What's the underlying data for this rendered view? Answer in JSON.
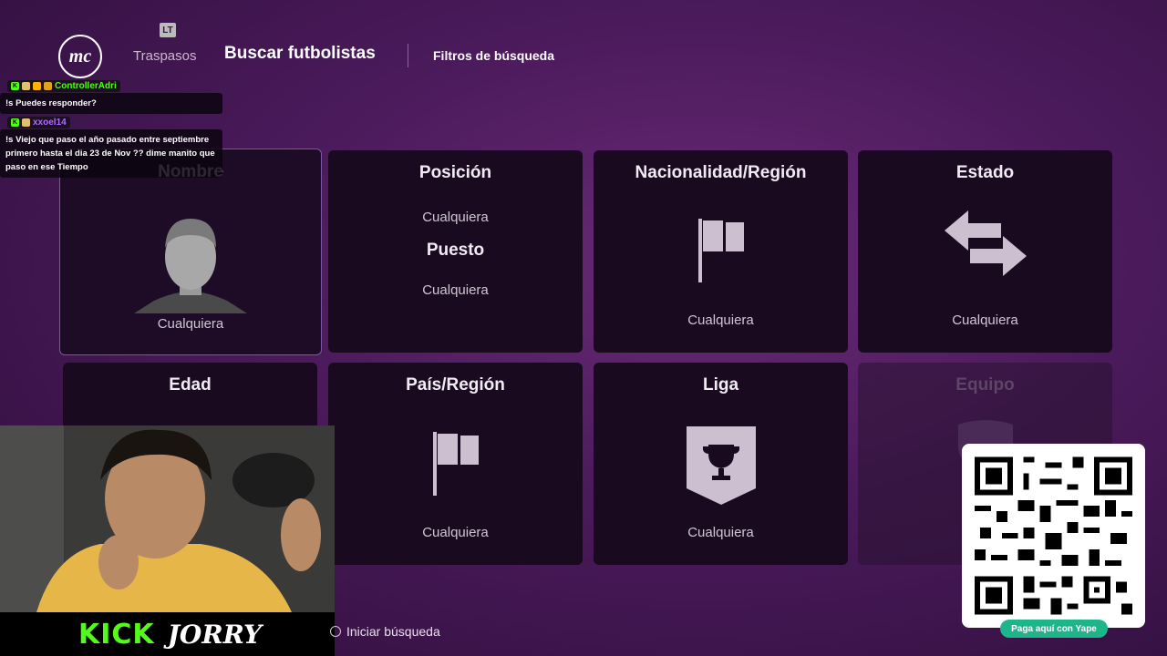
{
  "header": {
    "logo_text": "mc",
    "badge": "LT",
    "nav_transfers": "Traspasos",
    "nav_active": "Buscar futbolistas",
    "filters": "Filtros de búsqueda"
  },
  "chat": [
    {
      "user": "ControllerAdri",
      "user_color": "#53fc18",
      "text": "!s Puedes responder?"
    },
    {
      "user": "xxoel14",
      "user_color": "#b06bff",
      "text": "!s Viejo que paso el año pasado entre septiembre primero hasta el dia 23 de Nov ?? dime manito que paso en ese Tiempo"
    }
  ],
  "cards": {
    "nombre": {
      "title": "Nombre",
      "value": "Cualquiera"
    },
    "posicion": {
      "title": "Posición",
      "value": "Cualquiera",
      "title2": "Puesto",
      "value2": "Cualquiera"
    },
    "nacionalidad": {
      "title": "Nacionalidad/Región",
      "value": "Cualquiera"
    },
    "estado": {
      "title": "Estado",
      "value": "Cualquiera"
    },
    "edad": {
      "title": "Edad"
    },
    "pais": {
      "title": "País/Región",
      "value": "Cualquiera"
    },
    "liga": {
      "title": "Liga",
      "value": "Cualquiera"
    },
    "equipo": {
      "title": "Equipo"
    }
  },
  "footer": {
    "start_search": "Iniciar búsqueda"
  },
  "overlay": {
    "kick": "KICK",
    "streamer": "JORRY",
    "pay": "Paga aquí con Yape"
  },
  "colors": {
    "accent": "#7d55a8",
    "kick_green": "#53fc18",
    "yape": "#1fb58a"
  }
}
